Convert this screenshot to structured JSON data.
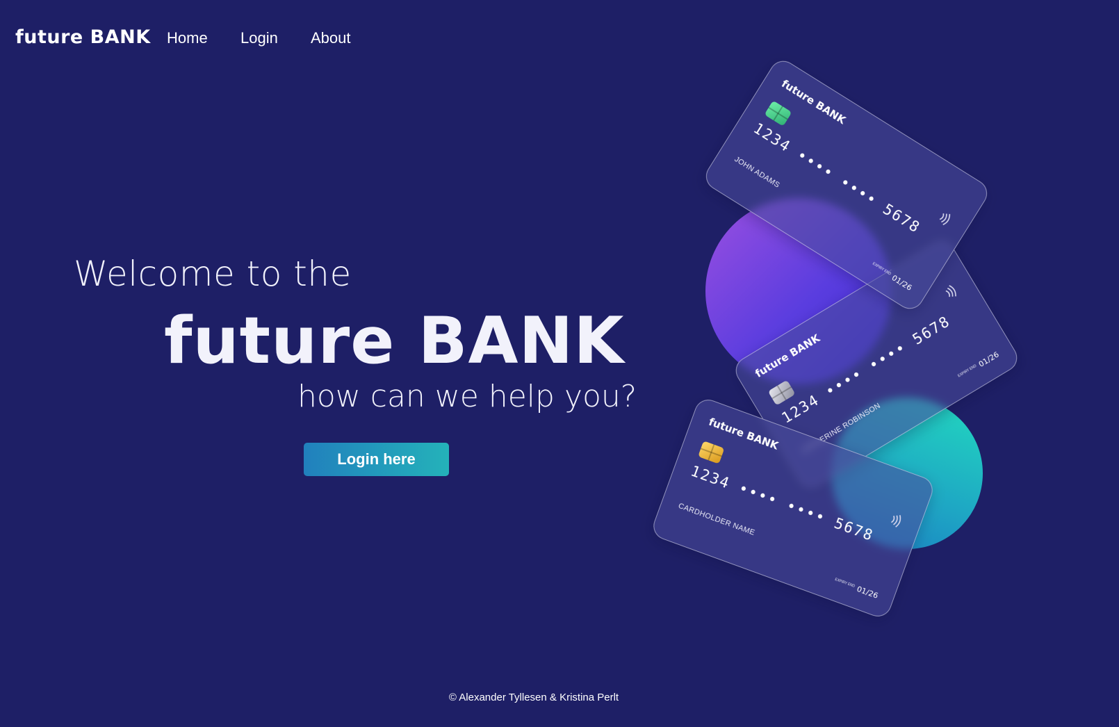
{
  "nav": {
    "brand": "future BANK",
    "links": [
      "Home",
      "Login",
      "About"
    ]
  },
  "hero": {
    "welcome": "Welcome to the",
    "brand": "future BANK",
    "tagline": "how can we help you?",
    "cta_label": "Login here"
  },
  "cards": [
    {
      "bank": "future BANK",
      "number": "1234 •••• •••• 5678",
      "holder": "JOHN ADAMS",
      "expiry_label": "EXPIRY END",
      "expiry": "01/26",
      "chip": "chip-green-icon"
    },
    {
      "bank": "future BANK",
      "number": "1234 •••• •••• 5678",
      "holder": "CATHERINE ROBINSON",
      "expiry_label": "EXPIRY END",
      "expiry": "01/26",
      "chip": "chip-silver-icon"
    },
    {
      "bank": "future BANK",
      "number": "1234 •••• •••• 5678",
      "holder": "CARDHOLDER NAME",
      "expiry_label": "EXPIRY END",
      "expiry": "01/26",
      "chip": "chip-gold-icon"
    }
  ],
  "footer": {
    "copyright": "© Alexander Tyllesen & Kristina Perlt"
  },
  "colors": {
    "background": "#1e1f66",
    "cta_gradient_start": "#2180bd",
    "cta_gradient_end": "#24b2ba",
    "blob_purple": "#7a45e0",
    "blob_teal": "#22c9c0"
  }
}
